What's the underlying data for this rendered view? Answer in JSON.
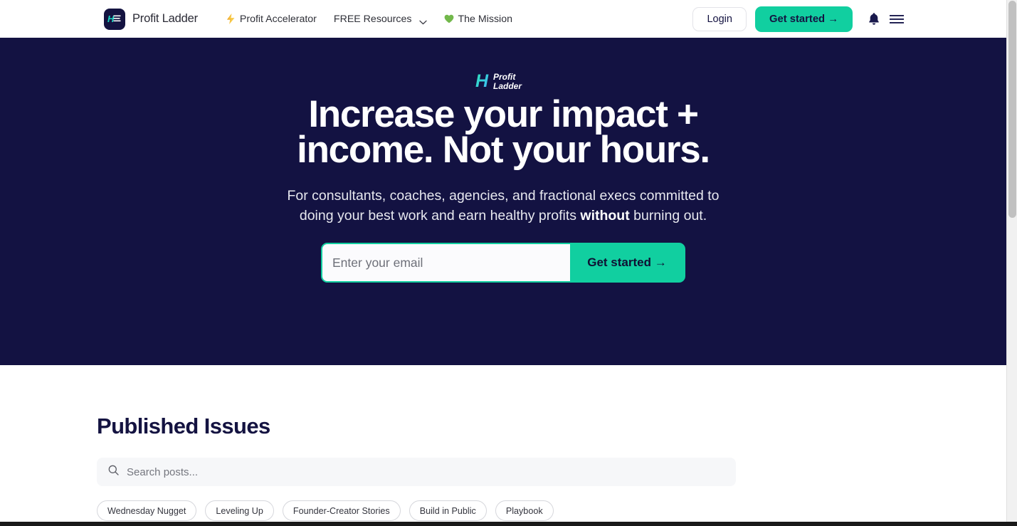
{
  "colors": {
    "navy": "#131242",
    "teal": "#11cfa0",
    "white": "#ffffff",
    "text_dark": "#2f3038",
    "search_bg": "#f6f7f9"
  },
  "navbar": {
    "brand": {
      "name": "Profit Ladder",
      "logo_letter": "H",
      "logo_sub": "Profit Ladder"
    },
    "links": [
      {
        "label": "Profit Accelerator",
        "icon": "lightning-bolt-icon"
      },
      {
        "label": "FREE Resources",
        "icon": "chevron-down-icon"
      },
      {
        "label": "The Mission",
        "icon": "green-heart-icon"
      }
    ],
    "login_label": "Login",
    "get_started_label": "Get started →",
    "bell_icon": "bell-icon",
    "menu_icon": "hamburger-menu-icon"
  },
  "hero": {
    "logo_letter": "H",
    "logo_line1": "Profit",
    "logo_line2": "Ladder",
    "headline_line1": "Increase your impact +",
    "headline_line2": "income. Not your hours.",
    "sub_line1": "For consultants, coaches, agencies, and fractional execs committed to",
    "sub_pre": "doing your best work and earn healthy profits ",
    "sub_bold": "without",
    "sub_post": " burning out.",
    "email_placeholder": "Enter your email",
    "email_value": "",
    "cta_label": "Get started →"
  },
  "issues": {
    "title": "Published Issues",
    "search_placeholder": "Search posts...",
    "search_value": "",
    "search_icon": "search-icon",
    "tags": [
      "Wednesday Nugget",
      "Leveling Up",
      "Founder-Creator Stories",
      "Build in Public",
      "Playbook"
    ]
  }
}
